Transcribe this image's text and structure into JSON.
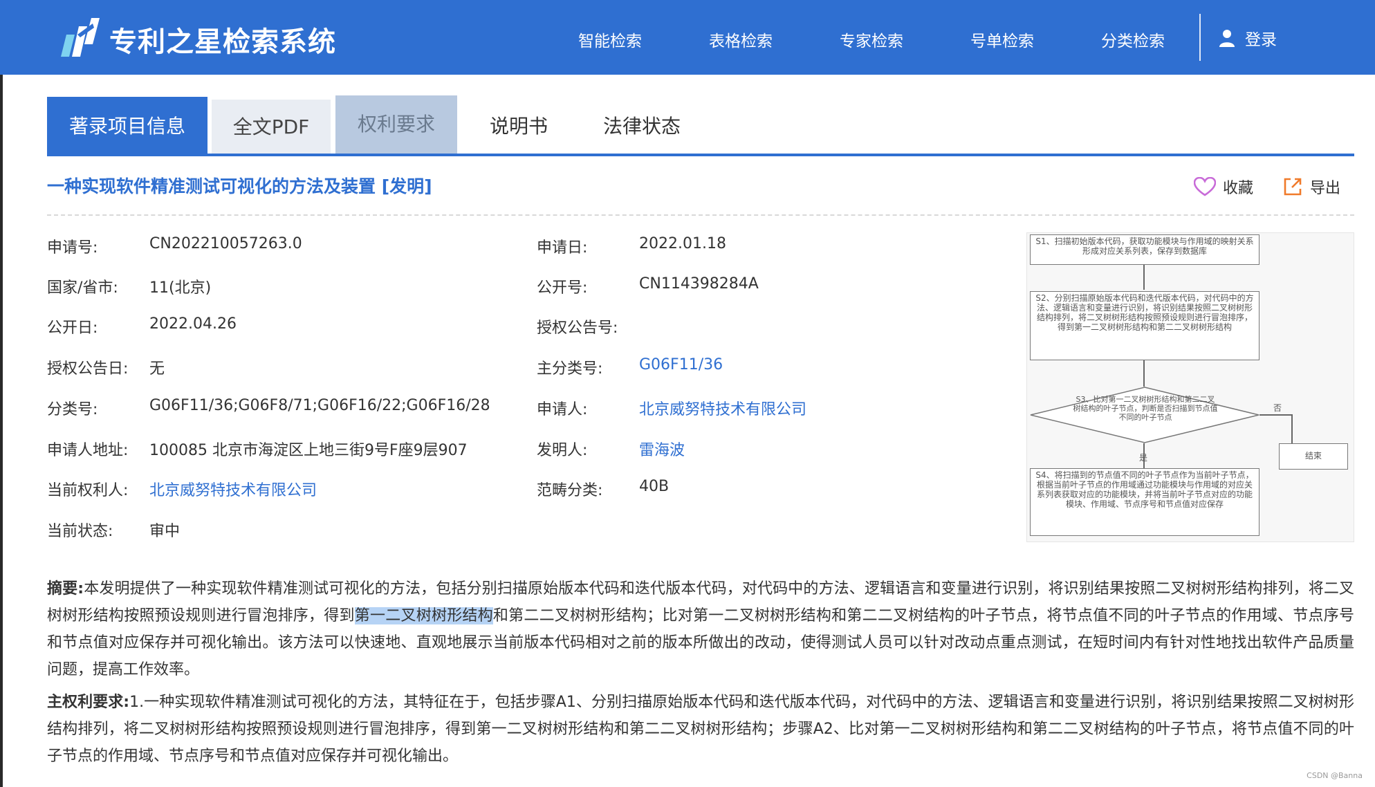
{
  "header": {
    "brand": "专利之星检索系统",
    "nav": [
      "智能检索",
      "表格检索",
      "专家检索",
      "号单检索",
      "分类检索"
    ],
    "login": "登录",
    "color": "#2f6fd1"
  },
  "tabs": [
    "著录项目信息",
    "全文PDF",
    "权利要求",
    "说明书",
    "法律状态"
  ],
  "title": "一种实现软件精准测试可视化的方法及装置 [发明]",
  "actions": {
    "favorite": "收藏",
    "export": "导出"
  },
  "fields": {
    "app_no_label": "申请号:",
    "app_no": "CN202210057263.0",
    "app_date_label": "申请日:",
    "app_date": "2022.01.18",
    "country_label": "国家/省市:",
    "country": "11(北京)",
    "pub_no_label": "公开号:",
    "pub_no": "CN114398284A",
    "pub_date_label": "公开日:",
    "pub_date": "2022.04.26",
    "grant_no_label": "授权公告号:",
    "grant_no": "",
    "grant_date_label": "授权公告日:",
    "grant_date": "无",
    "main_class_label": "主分类号:",
    "main_class": "G06F11/36",
    "class_label": "分类号:",
    "class": "G06F11/36;G06F8/71;G06F16/22;G06F16/28",
    "applicant_label": "申请人:",
    "applicant": "北京威努特技术有限公司",
    "address_label": "申请人地址:",
    "address": "100085 北京市海淀区上地三街9号F座9层907",
    "inventor_label": "发明人:",
    "inventor": "雷海波",
    "owner_label": "当前权利人:",
    "owner": "北京威努特技术有限公司",
    "scope_label": "范畴分类:",
    "scope": "40B",
    "status_label": "当前状态:",
    "status": "审中"
  },
  "flowchart": {
    "s1": "S1、扫描初始版本代码，获取功能模块与作用域的映射关系形成对应关系列表，保存到数据库",
    "s2": "S2、分别扫描原始版本代码和迭代版本代码，对代码中的方法、逻辑语言和变量进行识别，将识别结果按照二叉树树形结构排列，将二叉树树形结构按照预设规则进行冒泡排序，得到第一二叉树树形结构和第二二叉树树形结构",
    "s3": "S3、比对第一二叉树树形结构和第二二叉树结构的叶子节点，判断是否扫描到节点值不同的叶子节点",
    "no": "否",
    "yes": "是",
    "end": "结束",
    "s4": "S4、将扫描到的节点值不同的叶子节点作为当前叶子节点，根据当前叶子节点的作用域通过功能模块与作用域的对应关系列表获取对应的功能模块，并将当前叶子节点对应的功能模块、作用域、节点序号和节点值对应保存"
  },
  "abstract": {
    "label": "摘要:",
    "part1": "本发明提供了一种实现软件精准测试可视化的方法，包括分别扫描原始版本代码和迭代版本代码，对代码中的方法、逻辑语言和变量进行识别，将识别结果按照二叉树树形结构排列，将二叉树树形结构按照预设规则进行冒泡排序，得到",
    "highlight": "第一二叉树树形结构",
    "part2": "和第二二叉树树形结构；比对第一二叉树树形结构和第二二叉树结构的叶子节点，将节点值不同的叶子节点的作用域、节点序号和节点值对应保存并可视化输出。该方法可以快速地、直观地展示当前版本代码相对之前的版本所做出的改动，使得测试人员可以针对改动点重点测试，在短时间内有针对性地找出软件产品质量问题，提高工作效率。"
  },
  "claim": {
    "label": "主权利要求:",
    "text": "1.一种实现软件精准测试可视化的方法，其特征在于，包括步骤A1、分别扫描原始版本代码和迭代版本代码，对代码中的方法、逻辑语言和变量进行识别，将识别结果按照二叉树树形结构排列，将二叉树树形结构按照预设规则进行冒泡排序，得到第一二叉树树形结构和第二二叉树树形结构；步骤A2、比对第一二叉树树形结构和第二二叉树结构的叶子节点，将节点值不同的叶子节点的作用域、节点序号和节点值对应保存并可视化输出。"
  },
  "watermark": "CSDN @Banna"
}
